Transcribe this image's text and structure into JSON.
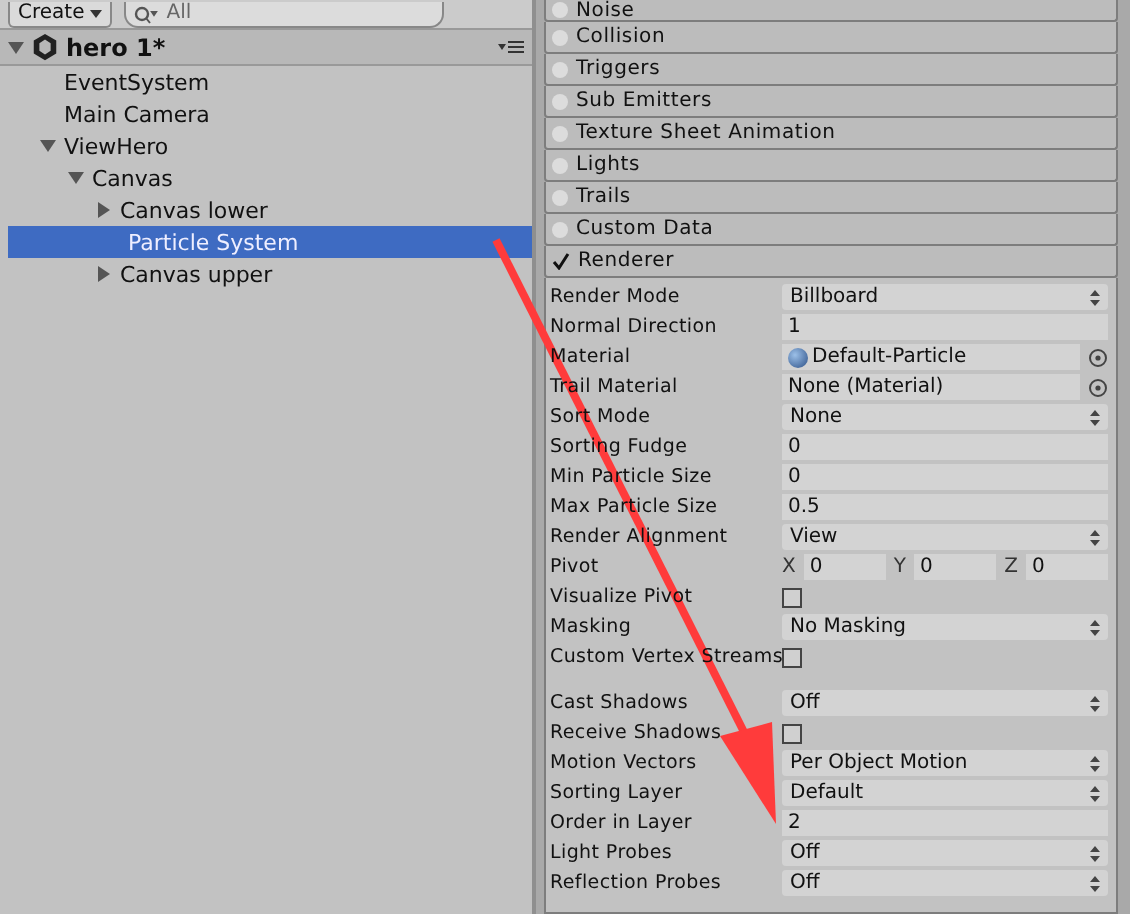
{
  "toolbar": {
    "create_label": "Create",
    "search_placeholder": "All"
  },
  "hierarchy": {
    "scene": {
      "name": "hero 1*",
      "expanded": true
    },
    "items": [
      {
        "name": "EventSystem",
        "selected": false
      },
      {
        "name": "Main Camera",
        "selected": false
      },
      {
        "name": "ViewHero",
        "selected": false,
        "expanded": true,
        "children": [
          {
            "name": "Canvas",
            "selected": false,
            "expanded": true,
            "children": [
              {
                "name": "Canvas lower",
                "selected": false,
                "expanded": false
              },
              {
                "name": "Particle System",
                "selected": true
              },
              {
                "name": "Canvas upper",
                "selected": false,
                "expanded": false
              }
            ]
          }
        ]
      }
    ]
  },
  "modules": [
    {
      "name": "Noise",
      "enabled": false
    },
    {
      "name": "Collision",
      "enabled": false
    },
    {
      "name": "Triggers",
      "enabled": false
    },
    {
      "name": "Sub Emitters",
      "enabled": false
    },
    {
      "name": "Texture Sheet Animation",
      "enabled": false
    },
    {
      "name": "Lights",
      "enabled": false
    },
    {
      "name": "Trails",
      "enabled": false
    },
    {
      "name": "Custom Data",
      "enabled": false
    },
    {
      "name": "Renderer",
      "enabled": true
    }
  ],
  "renderer_properties": [
    {
      "kind": "dropdown",
      "label": "Render Mode",
      "value": "Billboard"
    },
    {
      "kind": "field",
      "label": "Normal Direction",
      "value": "1"
    },
    {
      "kind": "object",
      "label": "Material",
      "value": "Default-Particle",
      "has_icon": true
    },
    {
      "kind": "object",
      "label": "Trail Material",
      "value": "None (Material)",
      "has_icon": false
    },
    {
      "kind": "dropdown",
      "label": "Sort Mode",
      "value": "None"
    },
    {
      "kind": "field",
      "label": "Sorting Fudge",
      "value": "0"
    },
    {
      "kind": "field",
      "label": "Min Particle Size",
      "value": "0"
    },
    {
      "kind": "field",
      "label": "Max Particle Size",
      "value": "0.5"
    },
    {
      "kind": "dropdown",
      "label": "Render Alignment",
      "value": "View"
    },
    {
      "kind": "vector3",
      "label": "Pivot",
      "axes": [
        {
          "axis": "X",
          "value": "0"
        },
        {
          "axis": "Y",
          "value": "0"
        },
        {
          "axis": "Z",
          "value": "0"
        }
      ]
    },
    {
      "kind": "checkbox",
      "label": "Visualize Pivot",
      "checked": false
    },
    {
      "kind": "dropdown",
      "label": "Masking",
      "value": "No Masking"
    },
    {
      "kind": "checkbox",
      "label": "Custom Vertex Streams",
      "checked": false
    },
    {
      "kind": "spacer"
    },
    {
      "kind": "dropdown",
      "label": "Cast Shadows",
      "value": "Off"
    },
    {
      "kind": "checkbox",
      "label": "Receive Shadows",
      "checked": false
    },
    {
      "kind": "dropdown",
      "label": "Motion Vectors",
      "value": "Per Object Motion"
    },
    {
      "kind": "dropdown",
      "label": "Sorting Layer",
      "value": "Default"
    },
    {
      "kind": "field",
      "label": "Order in Layer",
      "value": "2"
    },
    {
      "kind": "dropdown",
      "label": "Light Probes",
      "value": "Off"
    },
    {
      "kind": "dropdown",
      "label": "Reflection Probes",
      "value": "Off"
    }
  ]
}
